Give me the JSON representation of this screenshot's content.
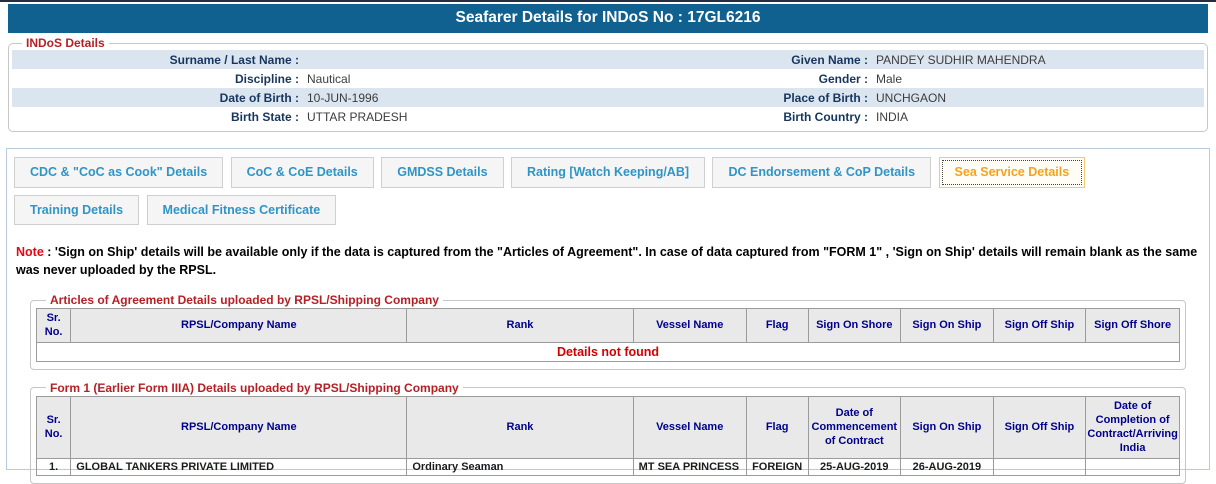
{
  "page": {
    "title": "Seafarer Details for INDoS No : 17GL6216"
  },
  "colors": {
    "title_bar": "#10618f",
    "section_title": "#b52025",
    "field_label": "#17365d",
    "row_stripe": "#dbe5f0",
    "tab_inactive_text": "#2e95c6",
    "tab_active_text": "#f5a31e",
    "note_red": "#e30613",
    "table_header_text": "#00008b",
    "not_found_red": "#d40000"
  },
  "indos": {
    "legend": "INDoS Details",
    "fields": [
      {
        "label": "Surname / Last Name :",
        "value": ""
      },
      {
        "label": "Given Name :",
        "value": "PANDEY SUDHIR MAHENDRA"
      },
      {
        "label": "Discipline :",
        "value": "Nautical"
      },
      {
        "label": "Gender :",
        "value": "Male"
      },
      {
        "label": "Date of Birth :",
        "value": "10-JUN-1996"
      },
      {
        "label": "Place of Birth :",
        "value": "UNCHGAON"
      },
      {
        "label": "Birth State :",
        "value": "UTTAR PRADESH"
      },
      {
        "label": "Birth Country :",
        "value": "INDIA"
      }
    ]
  },
  "tabs": {
    "items": [
      {
        "label": "CDC & \"CoC as Cook\" Details",
        "active": false
      },
      {
        "label": "CoC & CoE Details",
        "active": false
      },
      {
        "label": "GMDSS Details",
        "active": false
      },
      {
        "label": "Rating [Watch Keeping/AB]",
        "active": false
      },
      {
        "label": "DC Endorsement & CoP Details",
        "active": false
      },
      {
        "label": "Sea Service Details",
        "active": true
      },
      {
        "label": "Training Details",
        "active": false
      },
      {
        "label": "Medical Fitness Certificate",
        "active": false
      }
    ]
  },
  "note": {
    "label": "Note",
    "colon": " : ",
    "body": "'Sign on Ship' details will be available only if the data is captured from the \"Articles of Agreement\". In case of data captured from \"FORM 1\" , 'Sign on Ship' details will remain blank as the same was never uploaded by the RPSL."
  },
  "articles": {
    "legend": "Articles of Agreement Details uploaded by RPSL/Shipping Company",
    "headers": [
      "Sr. No.",
      "RPSL/Company Name",
      "Rank",
      "Vessel Name",
      "Flag",
      "Sign On Shore",
      "Sign On Ship",
      "Sign Off Ship",
      "Sign Off Shore"
    ],
    "empty_message": "Details not found"
  },
  "form1": {
    "legend": "Form 1 (Earlier Form IIIA) Details uploaded by RPSL/Shipping Company",
    "headers": [
      "Sr. No.",
      "RPSL/Company Name",
      "Rank",
      "Vessel Name",
      "Flag",
      "Date of Commencement of Contract",
      "Sign On Ship",
      "Sign Off Ship",
      "Date of Completion of Contract/Arriving India"
    ],
    "rows": [
      {
        "cells": [
          "1.",
          "GLOBAL TANKERS PRIVATE LIMITED",
          "Ordinary Seaman",
          "MT SEA PRINCESS",
          "FOREIGN",
          "25-AUG-2019",
          "26-AUG-2019",
          "",
          ""
        ]
      }
    ]
  }
}
